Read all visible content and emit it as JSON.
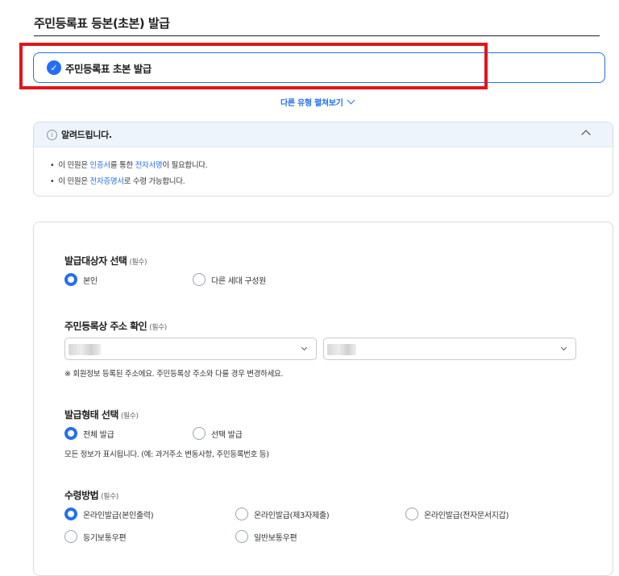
{
  "page": {
    "title": "주민등록표 등본(초본) 발급"
  },
  "selected_type": {
    "label": "주민등록표 초본 발급"
  },
  "more_types": {
    "label": "다른 유형 펼쳐보기"
  },
  "notice": {
    "title": "알려드립니다.",
    "items": [
      {
        "before": "이 민원은 ",
        "link": "인증서",
        "middle": "를 통한 ",
        "link2": "전자서명",
        "after": "이 필요합니다."
      },
      {
        "before": "이 민원은 ",
        "link": "전자증명서",
        "after": "로 수령 가능합니다."
      }
    ]
  },
  "form": {
    "required_tag": "(필수)",
    "target": {
      "title": "발급대상자 선택",
      "options": [
        "본인",
        "다른 세대 구성원"
      ],
      "selected": "본인"
    },
    "address": {
      "title": "주민등록상 주소 확인",
      "note": "※ 회원정보 등록된 주소에요. 주민등록상 주소와 다를 경우 변경하세요."
    },
    "issue_form": {
      "title": "발급형태 선택",
      "options": [
        "전체 발급",
        "선택 발급"
      ],
      "selected": "전체 발급",
      "note": "모든 정보가 표시됩니다. (예: 과거주소 변동사항, 주민등록번호 등)"
    },
    "receive": {
      "title": "수령방법",
      "options": [
        "온라인발급(본인출력)",
        "온라인발급(제3자제출)",
        "온라인발급(전자문서지갑)",
        "등기보통우편",
        "일반보통우편"
      ],
      "selected": "온라인발급(본인출력)"
    }
  },
  "colors": {
    "accent": "#256ef4",
    "highlight": "#e3141b"
  }
}
